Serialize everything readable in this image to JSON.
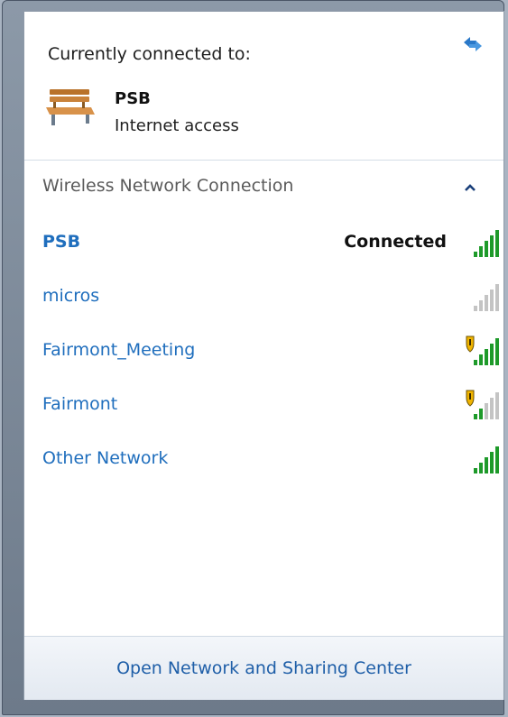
{
  "header": {
    "currently_connected_label": "Currently connected to:"
  },
  "current_connection": {
    "name": "PSB",
    "status": "Internet access",
    "icon": "bench-icon"
  },
  "section": {
    "title": "Wireless Network Connection"
  },
  "networks": [
    {
      "name": "PSB",
      "state": "Connected",
      "secured": false,
      "signal_bars": 5
    },
    {
      "name": "micros",
      "state": "",
      "secured": false,
      "signal_bars": 0
    },
    {
      "name": "Fairmont_Meeting",
      "state": "",
      "secured": true,
      "signal_bars": 5
    },
    {
      "name": "Fairmont",
      "state": "",
      "secured": true,
      "signal_bars": 2
    },
    {
      "name": "Other Network",
      "state": "",
      "secured": false,
      "signal_bars": 5
    }
  ],
  "footer": {
    "link_label": "Open Network and Sharing Center"
  },
  "colors": {
    "link": "#1f6ebd",
    "signal_on": "#1e9a2a",
    "signal_off": "#c4c4c4",
    "shield": "#f0b400"
  }
}
